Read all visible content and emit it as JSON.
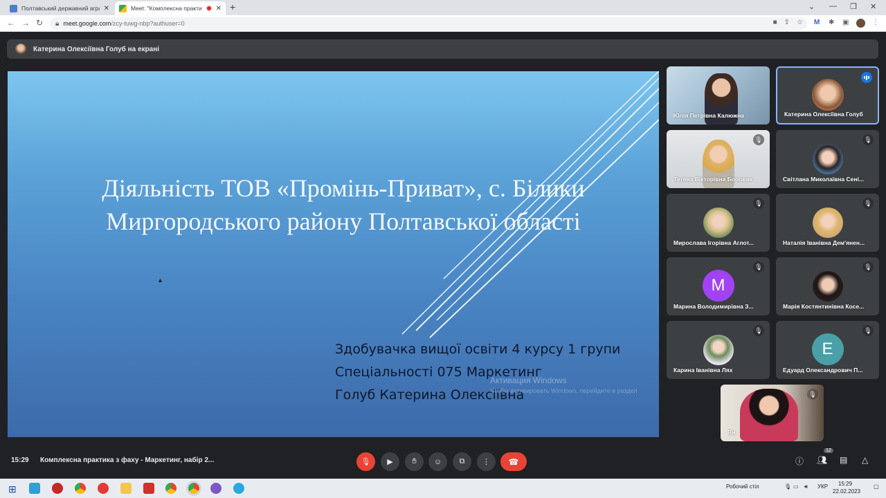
{
  "browser": {
    "tabs": [
      {
        "title": "Полтавський державний аграр...",
        "close": "✕"
      },
      {
        "title": "Meet: \"Комплексна практи...",
        "close": "✕"
      }
    ],
    "new_tab": "+",
    "url_host": "meet.google.com",
    "url_path": "/zcy-tuwg-nbp?authuser=0"
  },
  "meet": {
    "presenter_text": "Катерина Олексіївна Голуб на екрані",
    "slide": {
      "title_line1": "Діяльність ТОВ «Промінь-Приват», с. Білики",
      "title_line2": "Миргородського району Полтавської області",
      "sub_line1": "Здобувачка вищої освіти 4 курсу 1 групи",
      "sub_line2": "Спеціальності 075 Маркетинг",
      "sub_line3": "Голуб Катерина Олексіївна",
      "watermark_line1": "Активация Windows",
      "watermark_line2": "Чтобы активировать Windows, перейдите в раздел"
    },
    "participants": [
      {
        "name": "Юлія Петрівна Калюжна"
      },
      {
        "name": "Катерина Олексіївна Голуб"
      },
      {
        "name": "Тетяна Вікторівна Боровик"
      },
      {
        "name": "Світлана Миколаївна Сені..."
      },
      {
        "name": "Мирослава Ігорівна Аглот..."
      },
      {
        "name": "Наталія Іванівна Дем'янен..."
      },
      {
        "name": "Марина Володимирівна З...",
        "initial": "M"
      },
      {
        "name": "Марія Костянтинівна Косе..."
      },
      {
        "name": "Карина Іванівна Лях"
      },
      {
        "name": "Едуард Олександрович П...",
        "initial": "E"
      }
    ],
    "self_label": "Ви",
    "time": "15:29",
    "meeting_title": "Комплексна практика з фаху - Маркетинг, набір 2...",
    "participant_count": "12",
    "colors": {
      "end_call": "#ea4335",
      "active_border": "#8ab4f8",
      "avatar_m": "#a142f4",
      "avatar_e": "#4a9fa8"
    }
  },
  "taskbar": {
    "desktop_label": "Робочий стіл",
    "lang": "УКР",
    "time": "15:29",
    "date": "22.02.2023"
  }
}
